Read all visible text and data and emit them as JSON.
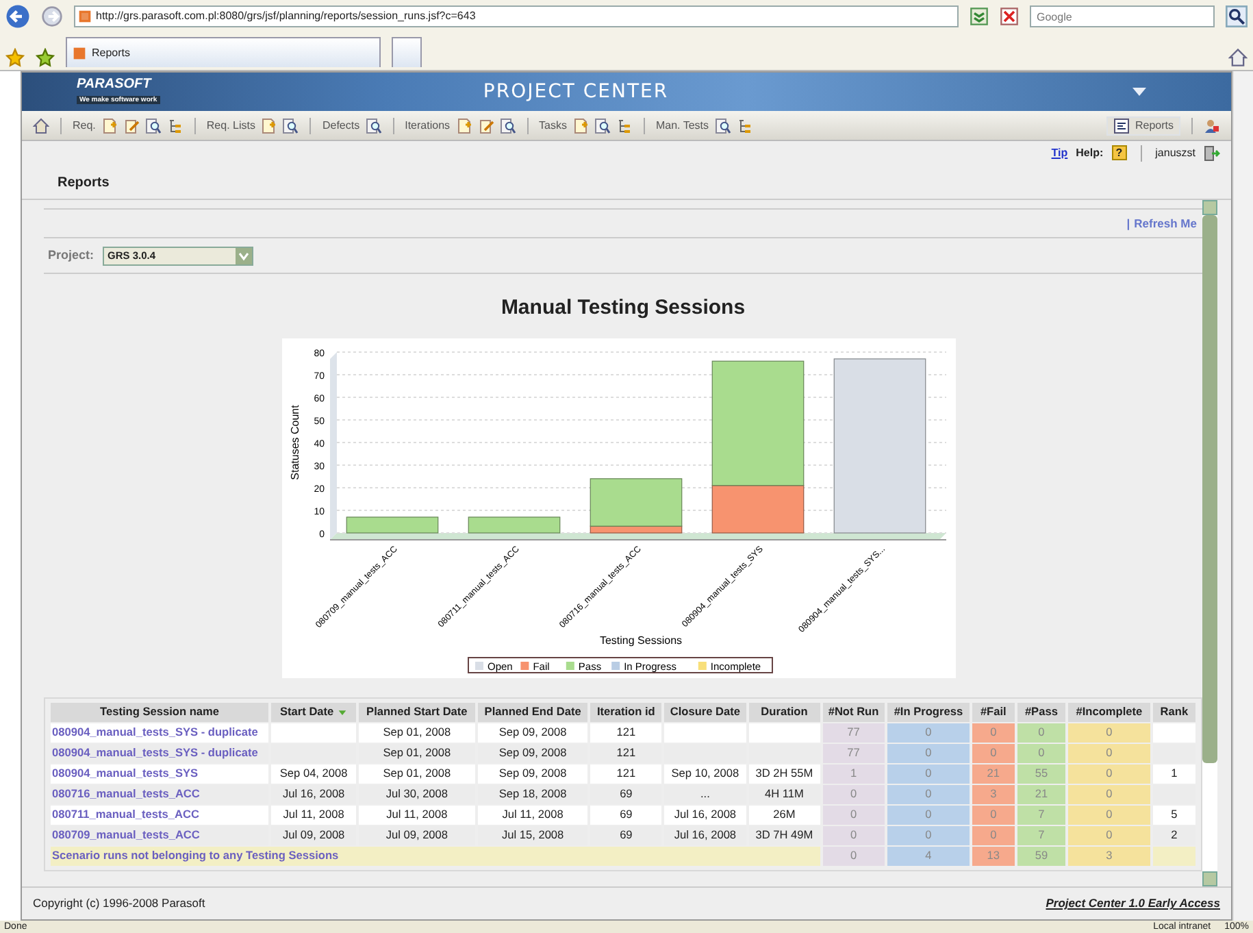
{
  "browser": {
    "url": "http://grs.parasoft.com.pl:8080/grs/jsf/planning/reports/session_runs.jsf?c=643",
    "search_placeholder": "Google",
    "tab": "Reports"
  },
  "header": {
    "logo": "PARASOFT",
    "tagline": "We make software work",
    "title": "PROJECT CENTER"
  },
  "toolbar": {
    "groups": [
      {
        "label": "Req."
      },
      {
        "label": "Req. Lists"
      },
      {
        "label": "Defects"
      },
      {
        "label": "Iterations"
      },
      {
        "label": "Tasks"
      },
      {
        "label": "Man. Tests"
      }
    ],
    "reports_button": "Reports"
  },
  "userbar": {
    "tip": "Tip",
    "help": "Help:",
    "help_icon": "?",
    "user": "januszst"
  },
  "page_title": "Reports",
  "refresh": {
    "separator": "|",
    "link": "Refresh Me"
  },
  "project": {
    "label": "Project:",
    "value": "GRS 3.0.4"
  },
  "report_title": "Manual Testing Sessions",
  "chart_data": {
    "type": "bar",
    "stacked": true,
    "xlabel": "Testing Sessions",
    "ylabel": "Statuses Count",
    "categories": [
      "080709_manual_tests_ACC",
      "080711_manual_tests_ACC",
      "080716_manual_tests_ACC",
      "080904_manual_tests_SYS",
      "080904_manual_tests_SYS..."
    ],
    "series": [
      {
        "name": "Open",
        "color": "#d9dee6",
        "values": [
          0,
          0,
          0,
          0,
          77
        ]
      },
      {
        "name": "Fail",
        "color": "#f7936f",
        "values": [
          0,
          0,
          3,
          21,
          0
        ]
      },
      {
        "name": "Pass",
        "color": "#a9dc8e",
        "values": [
          7,
          7,
          21,
          55,
          0
        ]
      },
      {
        "name": "In Progress",
        "color": "#b9cde4",
        "values": [
          0,
          0,
          0,
          0,
          0
        ]
      },
      {
        "name": "Incomplete",
        "color": "#f8df7a",
        "values": [
          0,
          0,
          0,
          0,
          0
        ]
      }
    ],
    "ylim": [
      0,
      80
    ],
    "grid": true,
    "legend": "bottom",
    "yticks": [
      0,
      10,
      20,
      30,
      40,
      50,
      60,
      70,
      80
    ]
  },
  "table": {
    "columns": [
      {
        "label": "Testing Session name"
      },
      {
        "label": "Start Date",
        "sorted": true
      },
      {
        "label": "Planned Start Date"
      },
      {
        "label": "Planned End Date"
      },
      {
        "label": "Iteration id"
      },
      {
        "label": "Closure Date"
      },
      {
        "label": "Duration"
      },
      {
        "label": "#Not Run",
        "color": "#e3dbe6"
      },
      {
        "label": "#In Progress",
        "color": "#b8d0ea"
      },
      {
        "label": "#Fail",
        "color": "#f6a98c"
      },
      {
        "label": "#Pass",
        "color": "#bfe0a6"
      },
      {
        "label": "#Incomplete",
        "color": "#f5e29c"
      },
      {
        "label": "Rank"
      }
    ],
    "rows": [
      {
        "cells": [
          "080904_manual_tests_SYS - duplicate",
          null,
          "Sep 01, 2008",
          "Sep 09, 2008",
          "121",
          null,
          null,
          "77",
          "0",
          "0",
          "0",
          "0",
          null
        ]
      },
      {
        "cells": [
          "080904_manual_tests_SYS - duplicate",
          null,
          "Sep 01, 2008",
          "Sep 09, 2008",
          "121",
          null,
          null,
          "77",
          "0",
          "0",
          "0",
          "0",
          null
        ]
      },
      {
        "cells": [
          "080904_manual_tests_SYS",
          "Sep 04, 2008",
          "Sep 01, 2008",
          "Sep 09, 2008",
          "121",
          "Sep 10, 2008",
          "3D 2H 55M",
          "1",
          "0",
          "21",
          "55",
          "0",
          "1"
        ]
      },
      {
        "cells": [
          "080716_manual_tests_ACC",
          "Jul 16, 2008",
          "Jul 30, 2008",
          "Sep 18, 2008",
          "69",
          "...",
          "4H 11M",
          "0",
          "0",
          "3",
          "21",
          "0",
          null
        ]
      },
      {
        "cells": [
          "080711_manual_tests_ACC",
          "Jul 11, 2008",
          "Jul 11, 2008",
          "Jul 11, 2008",
          "69",
          "Jul 16, 2008",
          "26M",
          "0",
          "0",
          "0",
          "7",
          "0",
          "5"
        ]
      },
      {
        "cells": [
          "080709_manual_tests_ACC",
          "Jul 09, 2008",
          "Jul 09, 2008",
          "Jul 15, 2008",
          "69",
          "Jul 16, 2008",
          "3D 7H 49M",
          "0",
          "0",
          "0",
          "7",
          "0",
          "2"
        ]
      }
    ],
    "summary": {
      "label": "Scenario runs not belonging to any Testing Sessions",
      "values": [
        "0",
        "4",
        "13",
        "59",
        "3"
      ]
    }
  },
  "footer": {
    "copyright": "Copyright (c) 1996-2008 Parasoft",
    "version": "Project Center 1.0 Early Access"
  },
  "status_bar": {
    "status": "Done",
    "zone": "Local intranet",
    "zoom": "100%"
  }
}
